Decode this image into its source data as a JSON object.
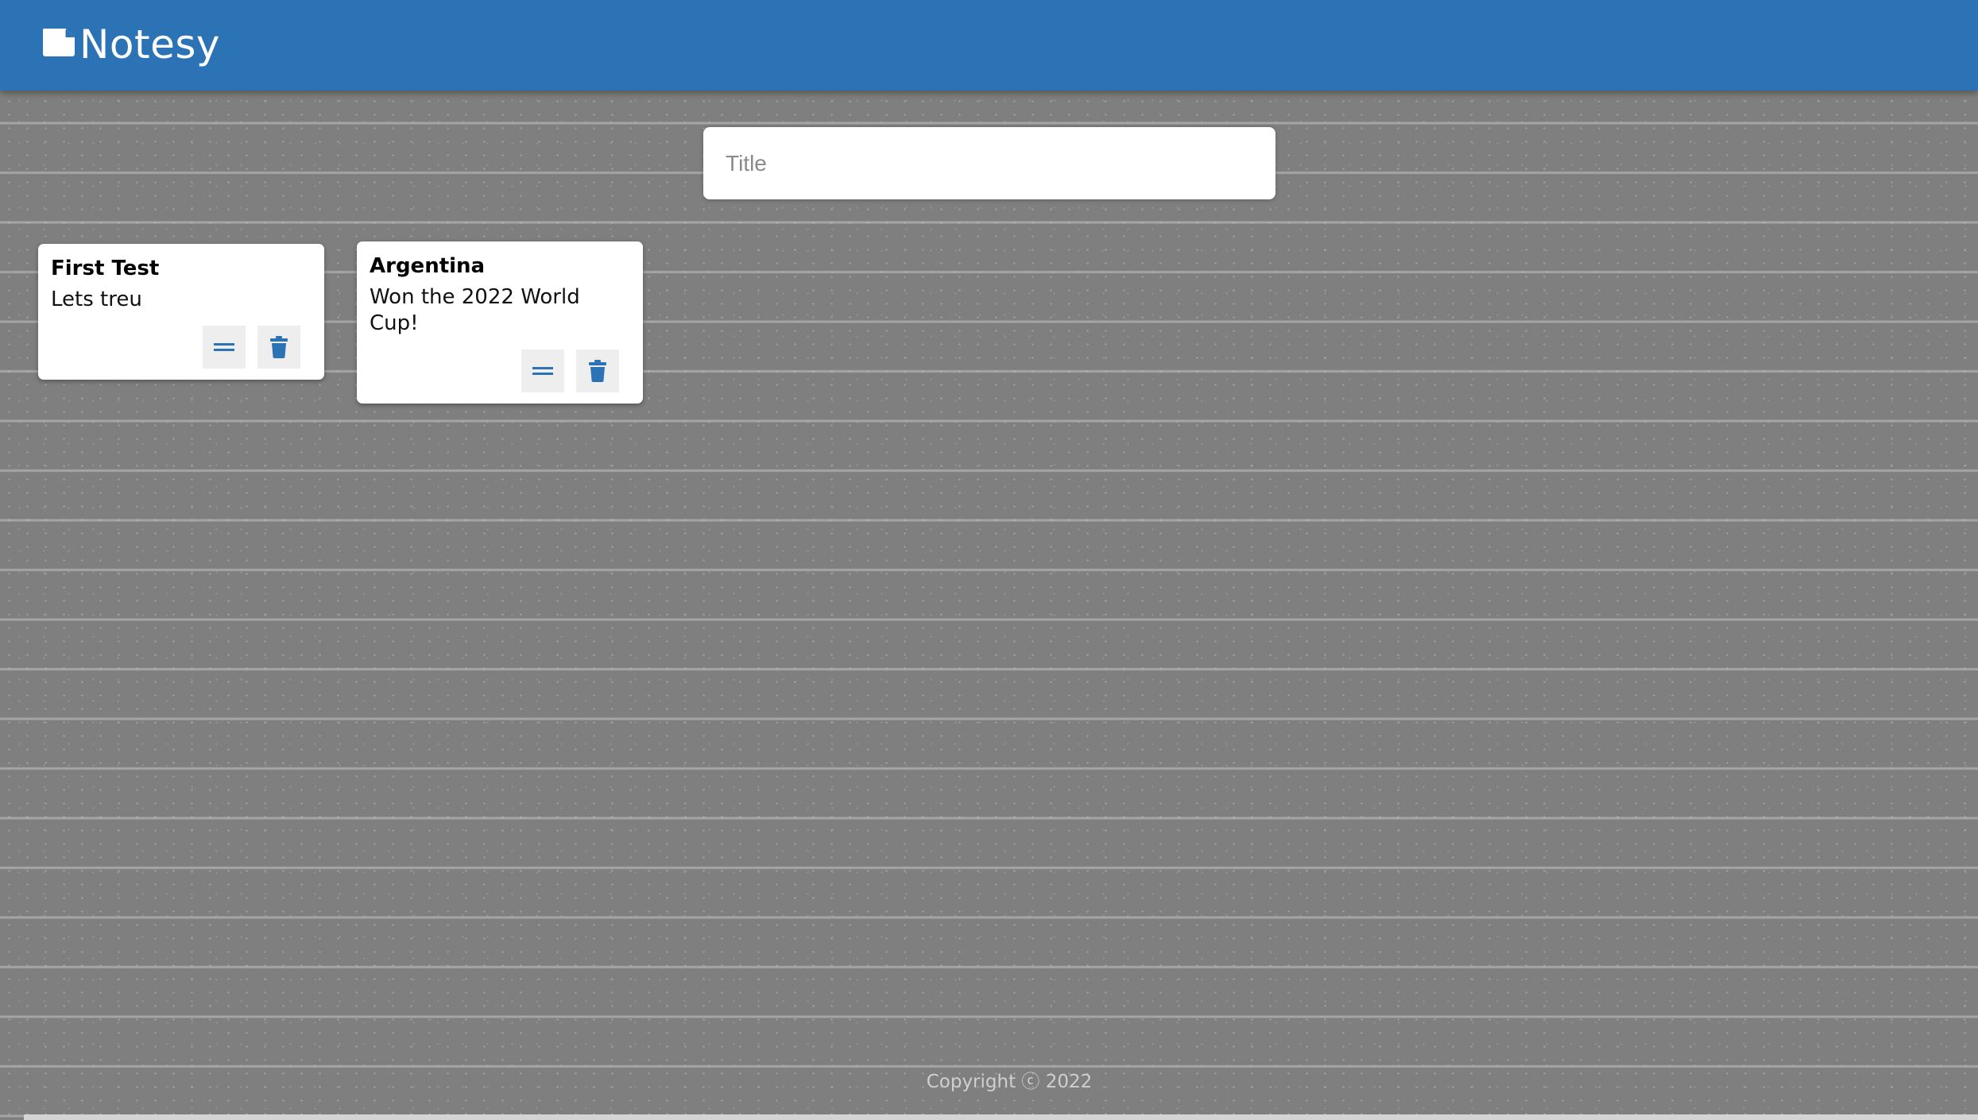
{
  "header": {
    "app_name": "Notesy",
    "logo_icon": "note-icon",
    "background_color": "#2c73b6"
  },
  "create_note": {
    "title_placeholder": "Title",
    "title_value": ""
  },
  "notes": [
    {
      "title": "First Test",
      "content": "Lets treu",
      "edit_icon": "drag-handle-icon",
      "delete_icon": "trash-icon"
    },
    {
      "title": "Argentina",
      "content": "Won the 2022 World Cup!",
      "edit_icon": "drag-handle-icon",
      "delete_icon": "trash-icon"
    }
  ],
  "footer": {
    "copyright": "Copyright ⓒ 2022"
  },
  "colors": {
    "accent": "#2c73b6",
    "background": "#7f7f7f",
    "card": "#ffffff",
    "button_bg": "#eeeeee"
  }
}
